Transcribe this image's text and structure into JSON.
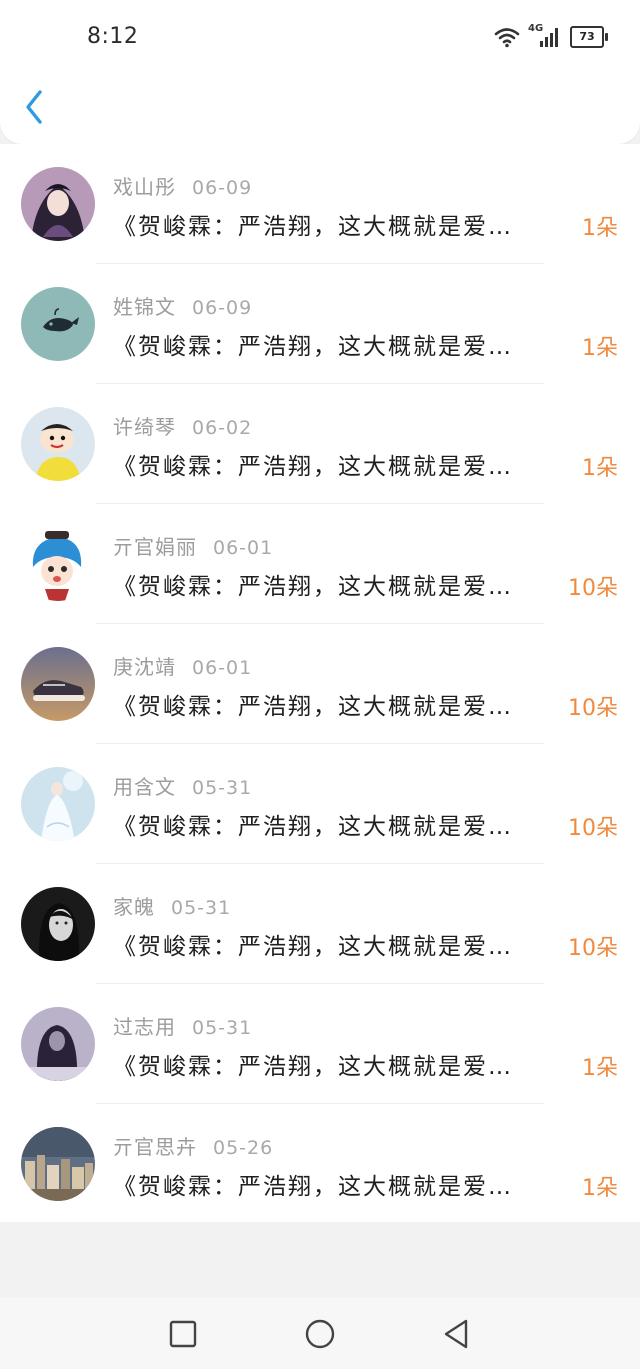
{
  "status_bar": {
    "time": "8:12",
    "network": "4G",
    "battery": "73"
  },
  "header": {
    "back_icon": "chevron-left-icon",
    "accent_color": "#2e9ae0"
  },
  "items": [
    {
      "name": "戏山彤",
      "date": "06-09",
      "message": "《贺峻霖：严浩翔，这大概就是爱…",
      "count": "1朵",
      "avatar": "anime-girl"
    },
    {
      "name": "姓锦文",
      "date": "06-09",
      "message": "《贺峻霖：严浩翔，这大概就是爱…",
      "count": "1朵",
      "avatar": "whale"
    },
    {
      "name": "许绮琴",
      "date": "06-02",
      "message": "《贺峻霖：严浩翔，这大概就是爱…",
      "count": "1朵",
      "avatar": "cartoon-boy"
    },
    {
      "name": "亓官娟丽",
      "date": "06-01",
      "message": "《贺峻霖：严浩翔，这大概就是爱…",
      "count": "10朵",
      "avatar": "cartoon-blue-hair"
    },
    {
      "name": "庚沈靖",
      "date": "06-01",
      "message": "《贺峻霖：严浩翔，这大概就是爱…",
      "count": "10朵",
      "avatar": "sneaker"
    },
    {
      "name": "用含文",
      "date": "05-31",
      "message": "《贺峻霖：严浩翔，这大概就是爱…",
      "count": "10朵",
      "avatar": "white-dress"
    },
    {
      "name": "家魄",
      "date": "05-31",
      "message": "《贺峻霖：严浩翔，这大概就是爱…",
      "count": "10朵",
      "avatar": "bw-portrait"
    },
    {
      "name": "过志用",
      "date": "05-31",
      "message": "《贺峻霖：严浩翔，这大概就是爱…",
      "count": "1朵",
      "avatar": "dark-hair-girl"
    },
    {
      "name": "亓官思卉",
      "date": "05-26",
      "message": "《贺峻霖：严浩翔，这大概就是爱…",
      "count": "1朵",
      "avatar": "city-skyline"
    }
  ],
  "nav_bar": {
    "recent_icon": "square-icon",
    "home_icon": "circle-icon",
    "back_icon": "triangle-back-icon"
  },
  "colors": {
    "count": "#f08a3e",
    "name": "#9c9c9c",
    "message": "#1f1f1f"
  }
}
